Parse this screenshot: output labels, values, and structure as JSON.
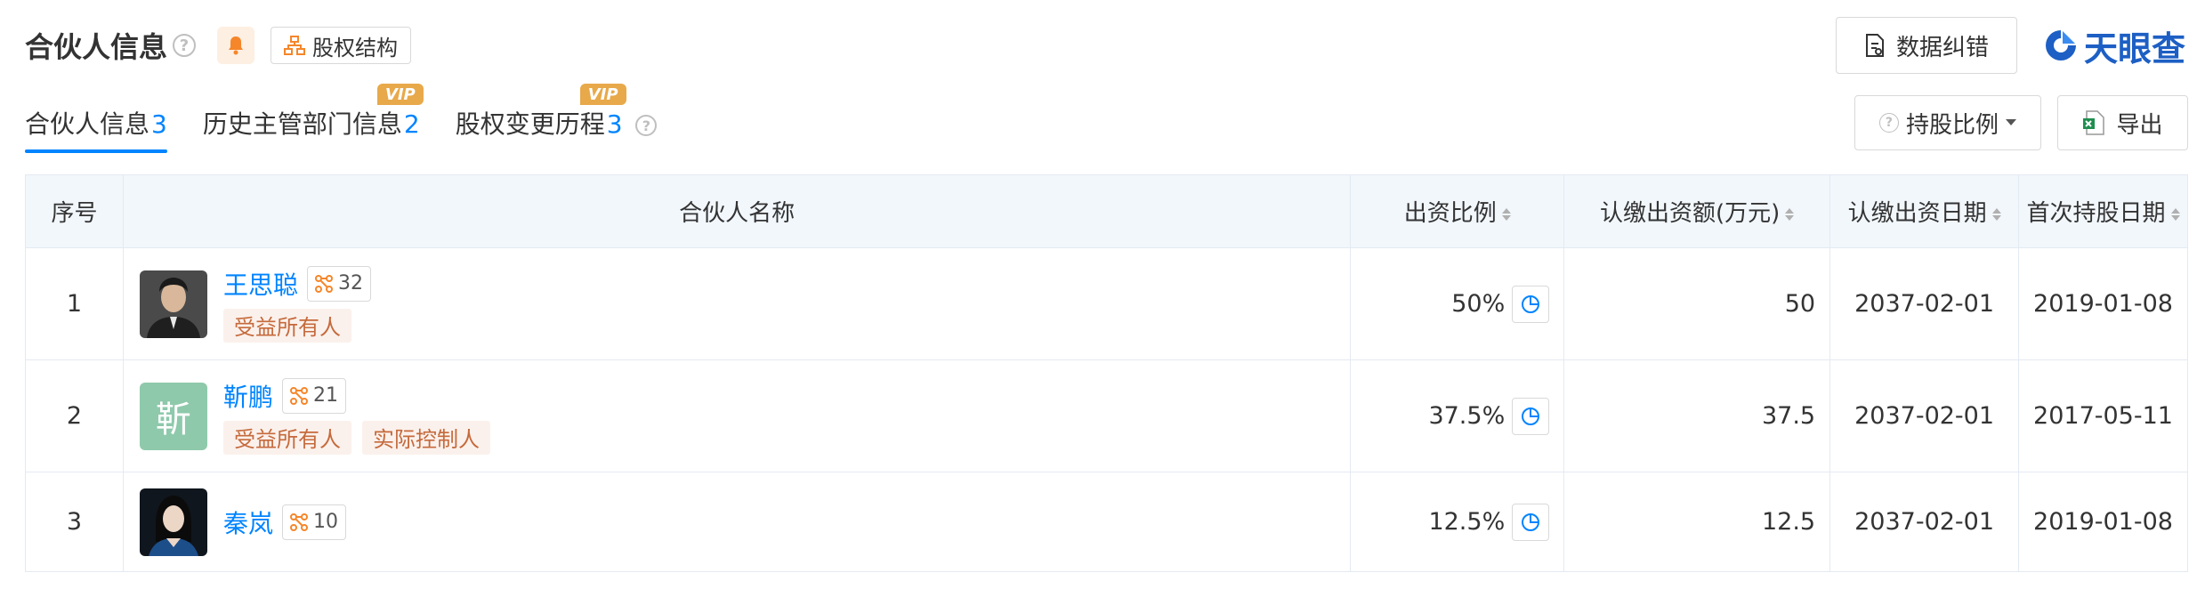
{
  "header": {
    "title": "合伙人信息",
    "equity_button": "股权结构",
    "data_fix_button": "数据纠错",
    "brand_name": "天眼查"
  },
  "tabs": [
    {
      "label": "合伙人信息",
      "count": "3",
      "active": true
    },
    {
      "label": "历史主管部门信息",
      "count": "2",
      "vip": "VIP"
    },
    {
      "label": "股权变更历程",
      "count": "3",
      "vip": "VIP"
    }
  ],
  "toolbar": {
    "ratio_select": "持股比例",
    "export_button": "导出"
  },
  "table": {
    "columns": [
      "序号",
      "合伙人名称",
      "出资比例",
      "认缴出资额(万元)",
      "认缴出资日期",
      "首次持股日期"
    ],
    "rows": [
      {
        "index": "1",
        "name": "王思聪",
        "relations": "32",
        "tags": [
          "受益所有人"
        ],
        "ratio": "50%",
        "amount": "50",
        "subscribe_date": "2037-02-01",
        "first_date": "2019-01-08",
        "avatar": "photo"
      },
      {
        "index": "2",
        "name": "靳鹏",
        "avatar_text": "靳",
        "relations": "21",
        "tags": [
          "受益所有人",
          "实际控制人"
        ],
        "ratio": "37.5%",
        "amount": "37.5",
        "subscribe_date": "2037-02-01",
        "first_date": "2017-05-11",
        "avatar": "text"
      },
      {
        "index": "3",
        "name": "秦岚",
        "relations": "10",
        "tags": [],
        "ratio": "12.5%",
        "amount": "12.5",
        "subscribe_date": "2037-02-01",
        "first_date": "2019-01-08",
        "avatar": "photo"
      }
    ]
  },
  "colors": {
    "accent": "#0084ff",
    "tag_bg": "#fbf1ec",
    "tag_text": "#c56a3c",
    "vip": "#e8a94a",
    "header_bg": "#f2f7fc"
  },
  "icons": [
    "help-icon",
    "bell-icon",
    "org-chart-icon",
    "document-icon",
    "brand-logo-icon",
    "excel-icon",
    "pie-chart-icon",
    "relation-icon",
    "sort-icon",
    "caret-down-icon"
  ]
}
